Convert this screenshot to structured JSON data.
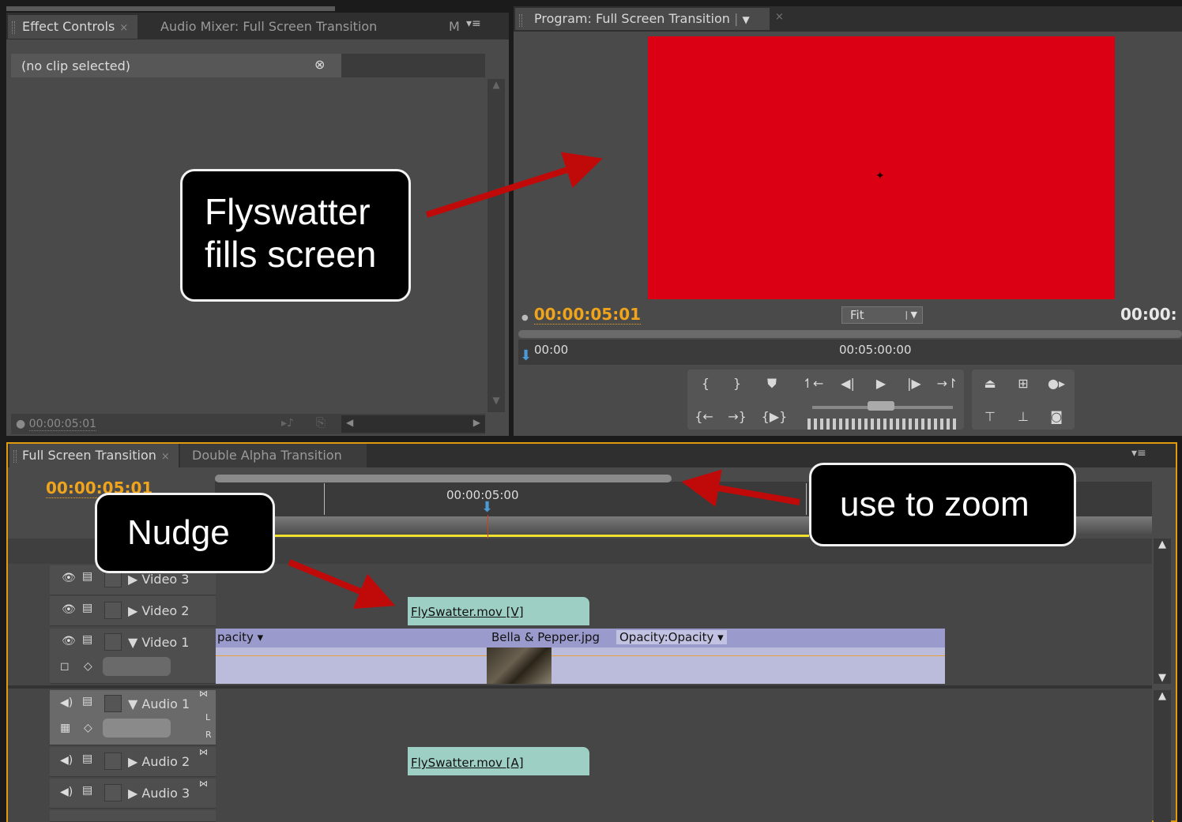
{
  "effect_controls": {
    "tab_effect_controls": "Effect Controls",
    "tab_audio_mixer": "Audio Mixer: Full Screen Transition",
    "tab_more": "M",
    "clip_status": "(no clip selected)",
    "timecode": "00:00:05:01"
  },
  "program_monitor": {
    "tab_title": "Program: Full Screen Transition",
    "timecode_current": "00:00:05:01",
    "zoom_select": "Fit",
    "timecode_duration": "00:00:",
    "ruler_start": "00:00",
    "ruler_mid": "00:05:00:00",
    "preview_color": "#dc0015"
  },
  "timeline": {
    "tab_active": "Full Screen Transition",
    "tab_other": "Double Alpha Transition",
    "timecode": "00:00:05:01",
    "ruler_label": "00:00:05:00",
    "tracks": {
      "video3": "Video 3",
      "video2": "Video 2",
      "video1": "Video 1",
      "audio1": "Audio 1",
      "audio2": "Audio 2",
      "audio3": "Audio 3",
      "audio1_l": "L",
      "audio1_r": "R"
    },
    "clips": {
      "flyswatter_v": "FlySwatter.mov [V]",
      "opacity_left": "pacity ▾",
      "bella": "Bella & Pepper.jpg",
      "bella_opacity": "Opacity:Opacity ▾",
      "flyswatter_a": "FlySwatter.mov [A]"
    }
  },
  "callouts": {
    "flyswatter_line1": "Flyswatter",
    "flyswatter_line2": "fills screen",
    "nudge": "Nudge",
    "zoom": "use to zoom"
  },
  "colors": {
    "accent_timecode": "#f0a41c",
    "playhead": "#d0401c",
    "annotation_arrow": "#c00a0a"
  }
}
